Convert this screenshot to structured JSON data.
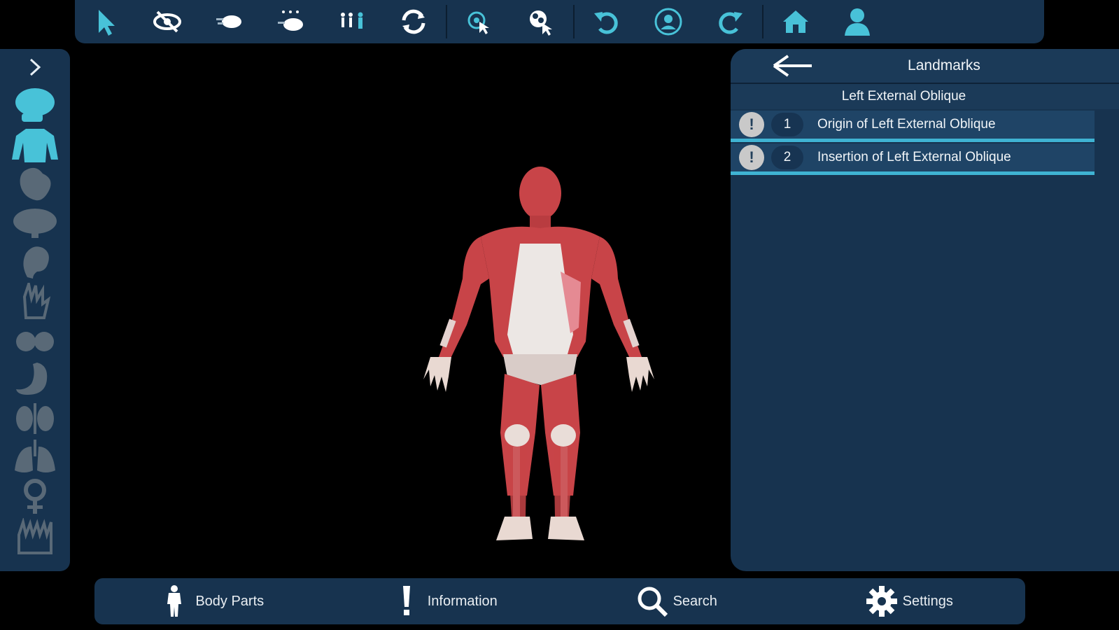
{
  "toolbar": {
    "icons": [
      "select-cursor-icon",
      "hide-eye-icon",
      "fade-icon",
      "fade-others-icon",
      "isolate-people-icon",
      "reset-rotate-icon",
      "select-region-icon",
      "explode-icon",
      "undo-icon",
      "profile-view-icon",
      "redo-icon",
      "home-icon",
      "user-icon"
    ],
    "accent": "#48c2d8"
  },
  "sidebar": {
    "toggle": ">",
    "items": [
      "skeleton-icon",
      "muscles-icon",
      "heart-icon",
      "brain-icon",
      "ear-icon",
      "hand-nerves-icon",
      "breast-icon",
      "stomach-icon",
      "kidneys-icon",
      "lungs-icon",
      "female-icon",
      "teeth-icon"
    ],
    "active_index": 1
  },
  "landmarks": {
    "title": "Landmarks",
    "subtitle": "Left External Oblique",
    "rows": [
      {
        "number": "1",
        "label": "Origin of Left External Oblique"
      },
      {
        "number": "2",
        "label": "Insertion of Left External Oblique"
      }
    ]
  },
  "bottombar": {
    "body_parts": "Body Parts",
    "information": "Information",
    "search": "Search",
    "settings": "Settings"
  },
  "colors": {
    "panel": "#17334f",
    "accent": "#48c2d8",
    "muscle": "#c84448",
    "highlight": "#e58a93"
  }
}
